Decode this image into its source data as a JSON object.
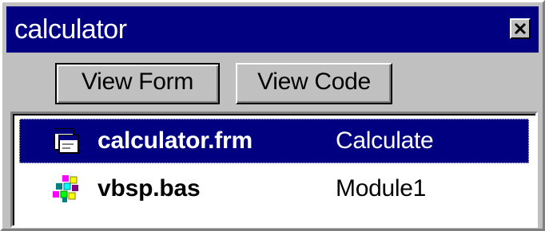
{
  "window": {
    "title": "calculator"
  },
  "toolbar": {
    "view_form_label": "View Form",
    "view_code_label": "View Code"
  },
  "items": [
    {
      "name": "calculator.frm",
      "description": "Calculate",
      "icon": "form-icon",
      "selected": true
    },
    {
      "name": "vbsp.bas",
      "description": "Module1",
      "icon": "module-icon",
      "selected": false
    }
  ],
  "colors": {
    "titlebar": "#000080",
    "selection": "#000080",
    "face": "#c0c0c0"
  }
}
